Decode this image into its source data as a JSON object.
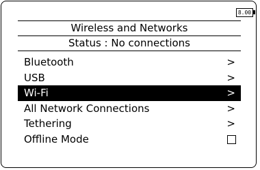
{
  "status_bar": {
    "battery_text": "8.00"
  },
  "header": {
    "title": "Wireless and Networks",
    "status": "Status : No connections"
  },
  "menu": {
    "items": [
      {
        "label": "Bluetooth",
        "indicator": ">"
      },
      {
        "label": "USB",
        "indicator": ">"
      },
      {
        "label": "Wi-Fi",
        "indicator": ">"
      },
      {
        "label": "All Network Connections",
        "indicator": ">"
      },
      {
        "label": "Tethering",
        "indicator": ">"
      },
      {
        "label": "Offline Mode"
      }
    ],
    "selected_index": 2,
    "offline_mode_checked": false
  }
}
